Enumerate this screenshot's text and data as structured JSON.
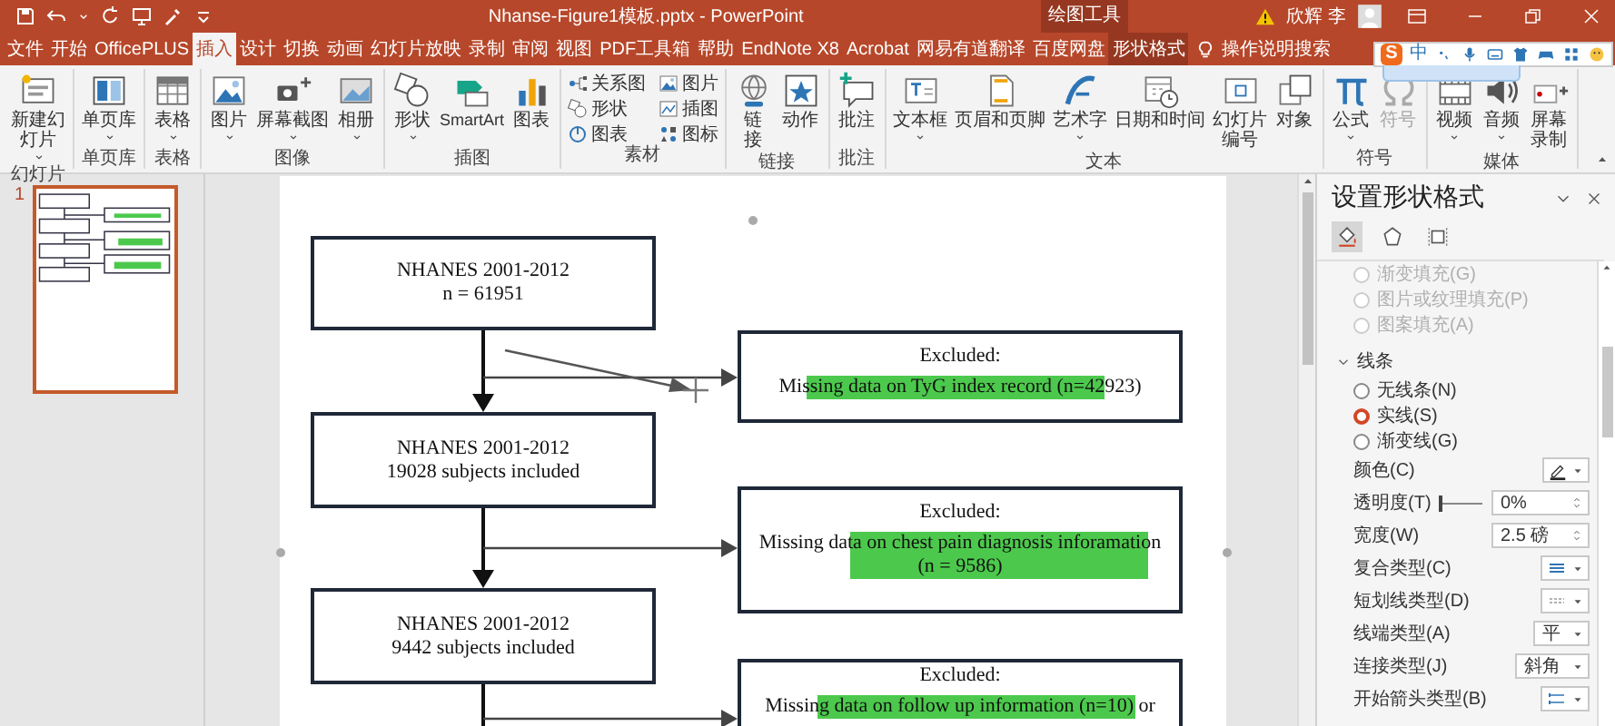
{
  "title_bar": {
    "title": "Nhanse-Figure1模板.pptx - PowerPoint",
    "context_label": "绘图工具",
    "user": "欣辉 李"
  },
  "tabs": [
    {
      "label": "文件",
      "kind": "normal",
      "selected": false
    },
    {
      "label": "开始",
      "kind": "normal",
      "selected": false
    },
    {
      "label": "OfficePLUS",
      "kind": "normal",
      "selected": false
    },
    {
      "label": "插入",
      "kind": "normal",
      "selected": true
    },
    {
      "label": "设计",
      "kind": "normal",
      "selected": false
    },
    {
      "label": "切换",
      "kind": "normal",
      "selected": false
    },
    {
      "label": "动画",
      "kind": "normal",
      "selected": false
    },
    {
      "label": "幻灯片放映",
      "kind": "normal",
      "selected": false
    },
    {
      "label": "录制",
      "kind": "normal",
      "selected": false
    },
    {
      "label": "审阅",
      "kind": "normal",
      "selected": false
    },
    {
      "label": "视图",
      "kind": "normal",
      "selected": false
    },
    {
      "label": "PDF工具箱",
      "kind": "normal",
      "selected": false
    },
    {
      "label": "帮助",
      "kind": "normal",
      "selected": false
    },
    {
      "label": "EndNote X8",
      "kind": "normal",
      "selected": false
    },
    {
      "label": "Acrobat",
      "kind": "normal",
      "selected": false
    },
    {
      "label": "网易有道翻译",
      "kind": "normal",
      "selected": false
    },
    {
      "label": "百度网盘",
      "kind": "normal",
      "selected": false
    },
    {
      "label": "形状格式",
      "kind": "contextual",
      "selected": false
    }
  ],
  "tell_me": {
    "label": "操作说明搜索"
  },
  "ime_bar": {
    "logo": "S",
    "mode": "中"
  },
  "ribbon": {
    "groups": [
      {
        "label": "幻灯片",
        "buttons": [
          {
            "label": "新建幻灯片",
            "kind": "large",
            "dropdown": true,
            "disabled": false
          }
        ]
      },
      {
        "label": "单页库",
        "buttons": [
          {
            "label": "单页库",
            "kind": "large",
            "dropdown": true,
            "disabled": false
          }
        ]
      },
      {
        "label": "表格",
        "buttons": [
          {
            "label": "表格",
            "kind": "large",
            "dropdown": true,
            "disabled": false
          }
        ]
      },
      {
        "label": "图像",
        "buttons": [
          {
            "label": "图片",
            "kind": "large",
            "dropdown": true,
            "disabled": false
          },
          {
            "label": "屏幕截图",
            "kind": "large",
            "dropdown": true,
            "disabled": false
          },
          {
            "label": "相册",
            "kind": "large",
            "dropdown": true,
            "disabled": false
          }
        ]
      },
      {
        "label": "插图",
        "buttons": [
          {
            "label": "形状",
            "kind": "large",
            "dropdown": true,
            "disabled": false
          },
          {
            "label": "SmartArt",
            "kind": "large",
            "dropdown": false,
            "disabled": false
          },
          {
            "label": "图表",
            "kind": "large",
            "dropdown": false,
            "disabled": false
          }
        ]
      },
      {
        "label": "素材",
        "buttons": [
          {
            "label": "关系图",
            "kind": "small",
            "dropdown": false,
            "disabled": false
          },
          {
            "label": "图片",
            "kind": "small",
            "dropdown": false,
            "disabled": false
          },
          {
            "label": "形状",
            "kind": "small",
            "dropdown": false,
            "disabled": false
          },
          {
            "label": "插图",
            "kind": "small",
            "dropdown": false,
            "disabled": false
          },
          {
            "label": "图表",
            "kind": "small",
            "dropdown": false,
            "disabled": false
          },
          {
            "label": "图标",
            "kind": "small",
            "dropdown": false,
            "disabled": false
          }
        ]
      },
      {
        "label": "链接",
        "buttons": [
          {
            "label": "链接",
            "kind": "large",
            "dropdown": false,
            "disabled": false
          },
          {
            "label": "动作",
            "kind": "large",
            "dropdown": false,
            "disabled": false
          }
        ]
      },
      {
        "label": "批注",
        "buttons": [
          {
            "label": "批注",
            "kind": "large",
            "dropdown": false,
            "disabled": false
          }
        ]
      },
      {
        "label": "文本",
        "buttons": [
          {
            "label": "文本框",
            "kind": "large",
            "dropdown": true,
            "disabled": false
          },
          {
            "label": "页眉和页脚",
            "kind": "large",
            "dropdown": false,
            "disabled": false
          },
          {
            "label": "艺术字",
            "kind": "large",
            "dropdown": true,
            "disabled": false
          },
          {
            "label": "日期和时间",
            "kind": "large",
            "dropdown": false,
            "disabled": false
          },
          {
            "label": "幻灯片编号",
            "kind": "large",
            "dropdown": false,
            "disabled": false
          },
          {
            "label": "对象",
            "kind": "large",
            "dropdown": false,
            "disabled": false
          }
        ]
      },
      {
        "label": "符号",
        "buttons": [
          {
            "label": "公式",
            "kind": "large",
            "dropdown": true,
            "disabled": false
          },
          {
            "label": "符号",
            "kind": "large",
            "dropdown": false,
            "disabled": true
          }
        ]
      },
      {
        "label": "媒体",
        "buttons": [
          {
            "label": "视频",
            "kind": "large",
            "dropdown": true,
            "disabled": false
          },
          {
            "label": "音频",
            "kind": "large",
            "dropdown": true,
            "disabled": false
          },
          {
            "label": "屏幕录制",
            "kind": "large",
            "dropdown": false,
            "disabled": false
          }
        ]
      }
    ]
  },
  "slide_panel": {
    "slides": [
      {
        "number": "1",
        "selected": true
      }
    ]
  },
  "slide": {
    "flow_boxes": [
      {
        "lines": [
          "NHANES 2001-2012",
          "n = 61951"
        ]
      },
      {
        "lines": [
          "NHANES 2001-2012",
          "19028 subjects included"
        ]
      },
      {
        "lines": [
          "NHANES 2001-2012",
          "9442 subjects included"
        ]
      }
    ],
    "excluded_boxes": [
      {
        "title": "Excluded:",
        "text": "Missing data on TyG index record (n=42923)"
      },
      {
        "title": "Excluded:",
        "text": "Missing data on chest pain diagnosis inforamation (n = 9586)"
      },
      {
        "title": "Excluded:",
        "text": "Missing data on follow up information (n=10) or"
      }
    ]
  },
  "format_pane": {
    "title": "设置形状格式",
    "tabs": [
      {
        "selected": true
      },
      {
        "selected": false
      },
      {
        "selected": false
      }
    ],
    "fill_options": [
      {
        "label": "渐变填充(G)",
        "selected": false,
        "disabled": true
      },
      {
        "label": "图片或纹理填充(P)",
        "selected": false,
        "disabled": true
      },
      {
        "label": "图案填充(A)",
        "selected": false,
        "disabled": true
      }
    ],
    "line_section": {
      "label": "线条",
      "expanded": true,
      "options": [
        {
          "label": "无线条(N)",
          "selected": false
        },
        {
          "label": "实线(S)",
          "selected": true
        },
        {
          "label": "渐变线(G)",
          "selected": false
        }
      ],
      "properties": [
        {
          "kind": "color",
          "label": "颜色(C)"
        },
        {
          "kind": "slider",
          "label": "透明度(T)",
          "level": 0,
          "value": "0%"
        },
        {
          "kind": "spin",
          "label": "宽度(W)",
          "value": "2.5 磅"
        },
        {
          "kind": "icon_dropdown",
          "label": "复合类型(C)"
        },
        {
          "kind": "icon_dropdown",
          "label": "短划线类型(D)"
        },
        {
          "kind": "dropdown",
          "label": "线端类型(A)",
          "value": "平"
        },
        {
          "kind": "dropdown",
          "label": "连接类型(J)",
          "value": "斜角"
        },
        {
          "kind": "icon_dropdown",
          "label": "开始箭头类型(B)"
        }
      ]
    }
  }
}
